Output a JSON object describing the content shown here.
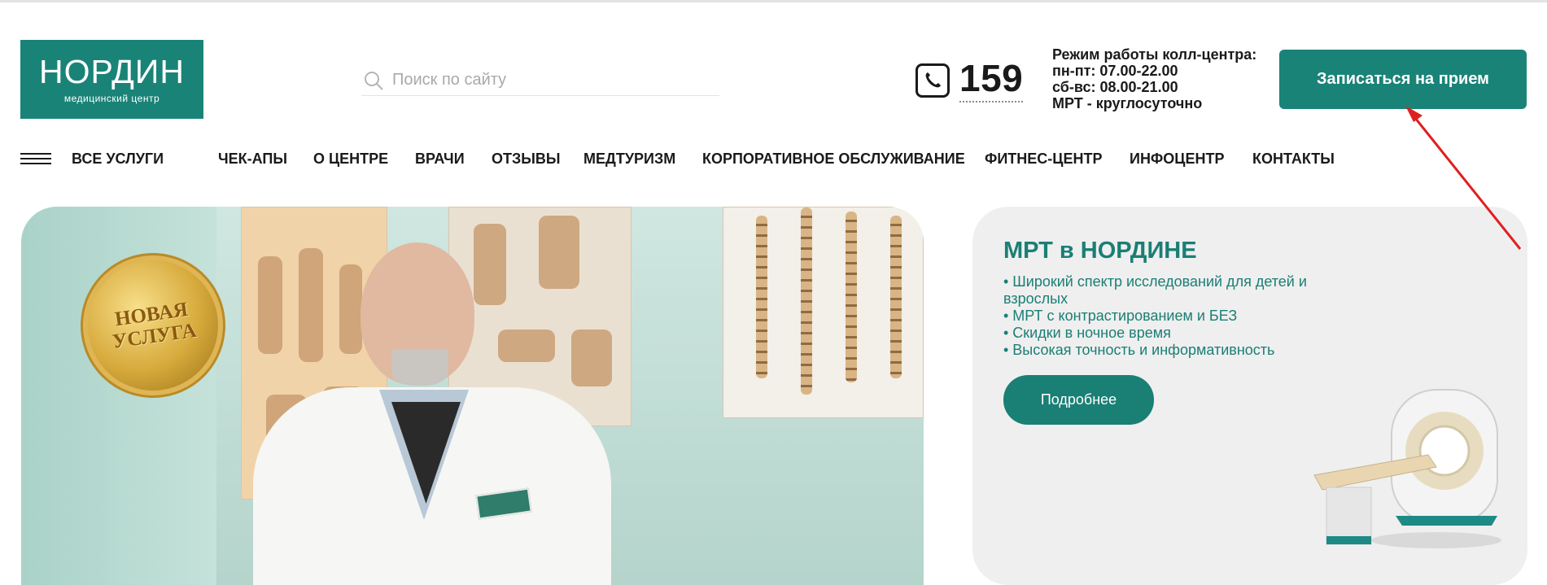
{
  "logo": {
    "title": "НОРДИН",
    "subtitle": "медицинский центр"
  },
  "search": {
    "placeholder": "Поиск по сайту",
    "value": ""
  },
  "phone": {
    "number": "159"
  },
  "schedule": {
    "title": "Режим работы колл-центра:",
    "lines": [
      "пн-пт: 07.00-22.00",
      "сб-вс: 08.00-21.00",
      "МРТ - круглосуточно"
    ]
  },
  "header": {
    "appointment_label": "Записаться на прием"
  },
  "nav": {
    "all_services": "ВСЕ УСЛУГИ",
    "items": [
      "ЧЕК-АПЫ",
      "О ЦЕНТРЕ",
      "ВРАЧИ",
      "ОТЗЫВЫ",
      "МЕДТУРИЗМ",
      "КОРПОРАТИВНОЕ ОБСЛУЖИВАНИЕ",
      "ФИТНЕС-ЦЕНТР",
      "ИНФОЦЕНТР",
      "КОНТАКТЫ"
    ]
  },
  "hero": {
    "seal_lines": [
      "НОВАЯ",
      "УСЛУГА"
    ]
  },
  "mrt_card": {
    "title": "МРТ в НОРДИНЕ",
    "bullets": [
      "• Широкий спектр исследований для детей и взрослых",
      "• МРТ с контрастированием и БЕЗ",
      "• Скидки в ночное время",
      "• Высокая точность и информативность"
    ],
    "button_label": "Подробнее"
  },
  "colors": {
    "brand": "#1a8378",
    "annotation_arrow": "#e02020"
  }
}
